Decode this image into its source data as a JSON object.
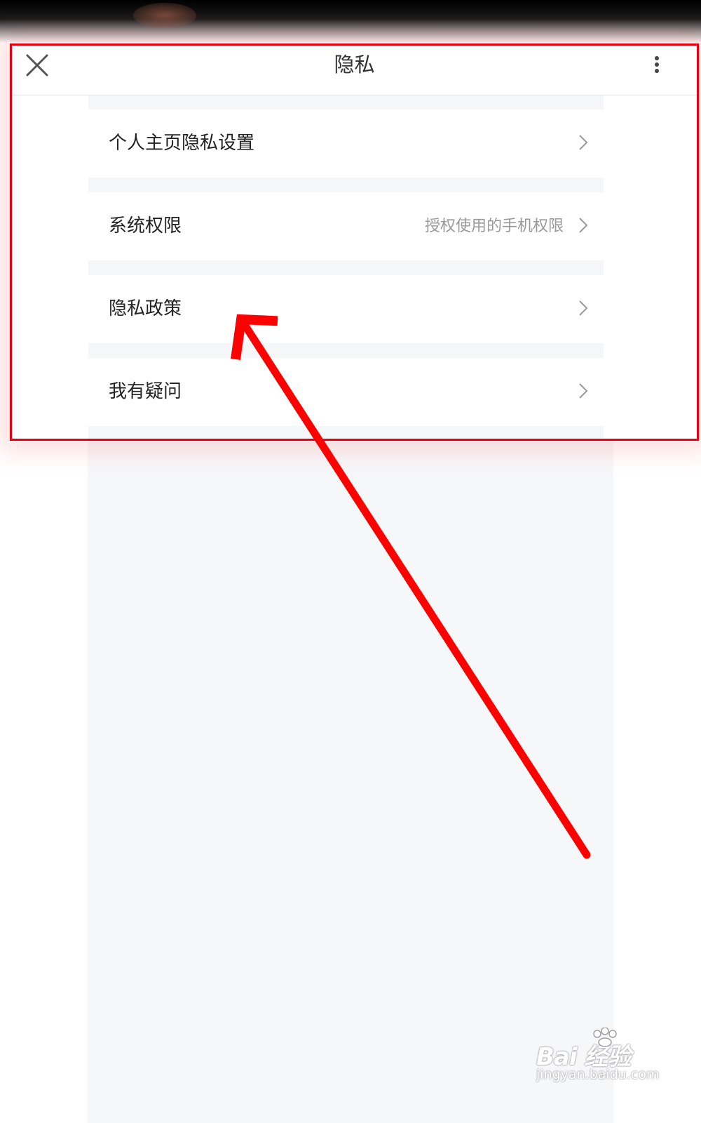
{
  "header": {
    "title": "隐私",
    "close_icon": "close-icon",
    "more_icon": "more-vertical-icon"
  },
  "items": [
    {
      "label": "个人主页隐私设置",
      "value": "",
      "icon": "chevron-right-icon"
    },
    {
      "label": "系统权限",
      "value": "授权使用的手机权限",
      "icon": "chevron-right-icon"
    },
    {
      "label": "隐私政策",
      "value": "",
      "icon": "chevron-right-icon"
    },
    {
      "label": "我有疑问",
      "value": "",
      "icon": "chevron-right-icon"
    }
  ],
  "annotation": {
    "highlight_color": "#e60012",
    "arrow_color": "#ff0000"
  },
  "watermark": {
    "brand": "Bai  经验",
    "url": "jingyan.baidu.com"
  }
}
